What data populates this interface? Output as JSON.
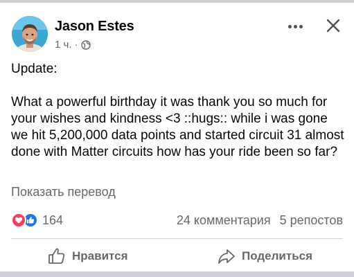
{
  "post": {
    "author": "Jason Estes",
    "time": "1 ч.",
    "separator": "·",
    "privacy_icon": "globe-icon",
    "text_lines": [
      "Update:",
      "",
      "What a powerful birthday it was thank you so much for your wishes and kindness <3 ::hugs:: while i was gone we hit 5,200,000 data points and started circuit 31 almost done with Matter circuits how has your ride been so far?"
    ],
    "translate_label": "Показать перевод"
  },
  "engagement": {
    "reaction_icons": [
      "love-icon",
      "like-icon"
    ],
    "reaction_count": "164",
    "comments": "24 комментария",
    "shares": "5 репостов"
  },
  "actions": {
    "like_label": "Нравится",
    "share_label": "Поделиться"
  },
  "colors": {
    "love": "#f33e58",
    "like": "#1877f2",
    "secondary_text": "#65676b"
  }
}
